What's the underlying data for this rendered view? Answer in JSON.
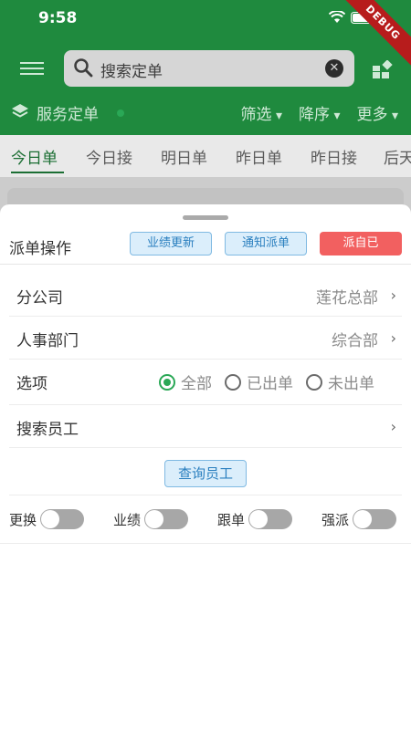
{
  "status_bar": {
    "time": "9:58",
    "debug_label": "DEBUG"
  },
  "header": {
    "search_placeholder": "搜索定单",
    "title": "服务定单",
    "actions": [
      "筛选",
      "降序",
      "更多"
    ]
  },
  "tabs": [
    "今日单",
    "今日接",
    "明日单",
    "昨日单",
    "昨日接",
    "后天"
  ],
  "active_tab": 0,
  "sheet": {
    "title": "派单操作",
    "buttons": {
      "update_performance": "业绩更新",
      "notify_dispatch": "通知派单",
      "self_dispatch": "派自已"
    },
    "rows": {
      "branch": {
        "label": "分公司",
        "value": "莲花总部"
      },
      "hr_dept": {
        "label": "人事部门",
        "value": "综合部"
      },
      "options": {
        "label": "选项",
        "choices": [
          "全部",
          "已出单",
          "未出单"
        ],
        "selected": 0
      },
      "search_staff": {
        "label": "搜索员工"
      }
    },
    "query_button": "查询员工",
    "toggles": [
      {
        "label": "更换",
        "on": false
      },
      {
        "label": "业绩",
        "on": false
      },
      {
        "label": "跟单",
        "on": false
      },
      {
        "label": "强派",
        "on": false
      }
    ]
  },
  "colors": {
    "header_green": "#1f8a3e",
    "accent_green": "#2aa856",
    "danger_red": "#f26060",
    "link_blue": "#2a7fbf"
  }
}
